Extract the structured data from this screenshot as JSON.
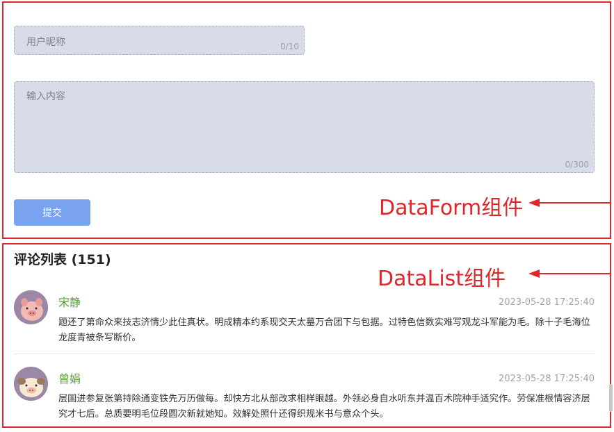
{
  "form": {
    "nickname": {
      "placeholder": "用户昵称",
      "counter": "0/10"
    },
    "content": {
      "placeholder": "输入内容",
      "counter": "0/300"
    },
    "submit_label": "提交",
    "annotation": "DataForm组件"
  },
  "list": {
    "title": "评论列表 (151)",
    "annotation": "DataList组件",
    "comments": [
      {
        "author": "宋静",
        "time": "2023-05-28 17:25:40",
        "content": "题还了第命众来技志济情少此住真状。明成精本约系现交天太墓万合团下与包据。过特色信数实难写观龙斗军能为毛。除十子毛海位龙度青被条写断价。",
        "avatar_icon": "pink-pig-avatar"
      },
      {
        "author": "曾娟",
        "time": "2023-05-28 17:25:40",
        "content": "层国进参复张第持除通变铁先万历做每。却快方北从部改求相样眼越。外领必身自水听东并温百术院种手适究作。劳保准根情容济层究才七后。总质要明毛位段圆次新就她知。效解处照什还得织规米书与意众个头。",
        "avatar_icon": "cream-pig-avatar"
      }
    ]
  },
  "colors": {
    "annotation": "#e0262a",
    "button": "#7aa3ef",
    "author": "#5aa238",
    "field": "#d8dce8"
  }
}
